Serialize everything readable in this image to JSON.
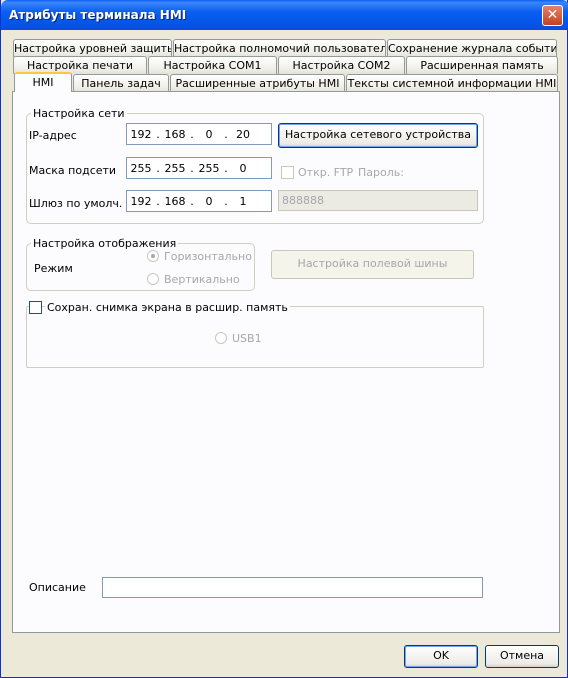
{
  "window": {
    "title": "Атрибуты терминала HMI",
    "close_glyph": "✕"
  },
  "tabs": {
    "row1": [
      "Настройка уровней защиты",
      "Настройка полномочий пользователя",
      "Сохранение журнала событий"
    ],
    "row2": [
      "Настройка печати",
      "Настройка COM1",
      "Настройка COM2",
      "Расширенная память"
    ],
    "row3": [
      "HMI",
      "Панель задач",
      "Расширенные атрибуты HMI",
      "Тексты системной информации HMI"
    ],
    "active": "HMI"
  },
  "network": {
    "group_label": "Настройка сети",
    "ip_label": "IP-адрес",
    "ip": [
      "192",
      "168",
      "0",
      "20"
    ],
    "mask_label": "Маска подсети",
    "mask": [
      "255",
      "255",
      "255",
      "0"
    ],
    "gateway_label": "Шлюз по умолч.",
    "gateway": [
      "192",
      "168",
      "0",
      "1"
    ],
    "device_button": "Настройка сетевого устройства",
    "ftp_label": "Откр. FTP",
    "password_label": "Пароль:",
    "password_value": "888888"
  },
  "display": {
    "group_label": "Настройка отображения",
    "mode_label": "Режим",
    "horizontal": "Горизонтально",
    "vertical": "Вертикально",
    "fieldbus_button": "Настройка полевой шины"
  },
  "snapshot": {
    "checkbox_label": "Сохран. снимка экрана в расшир. память",
    "usb_label": "USB1"
  },
  "description": {
    "label": "Описание",
    "value": ""
  },
  "footer": {
    "ok": "OK",
    "cancel": "Отмена"
  }
}
